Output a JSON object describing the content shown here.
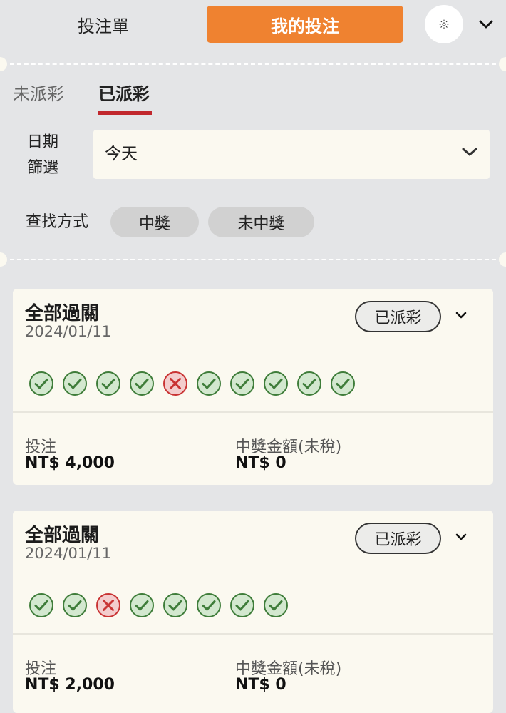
{
  "header": {
    "tab_betslip": "投注單",
    "tab_mybets": "我的投注",
    "accent_color": "#ef8230"
  },
  "subtabs": {
    "unsettled": "未派彩",
    "settled": "已派彩"
  },
  "filter": {
    "date_label": "日期篩選",
    "date_value": "今天",
    "search_label": "查找方式",
    "options": [
      "中獎",
      "未中獎"
    ]
  },
  "bets": [
    {
      "type": "全部過關",
      "date": "2024/01/11",
      "status": "已派彩",
      "legs": [
        "win",
        "win",
        "win",
        "win",
        "lose",
        "win",
        "win",
        "win",
        "win",
        "win"
      ],
      "stake_label": "投注",
      "stake": "NT$ 4,000",
      "payout_label": "中獎金額(未稅)",
      "payout": "NT$ 0"
    },
    {
      "type": "全部過關",
      "date": "2024/01/11",
      "status": "已派彩",
      "legs": [
        "win",
        "win",
        "lose",
        "win",
        "win",
        "win",
        "win",
        "win"
      ],
      "stake_label": "投注",
      "stake": "NT$ 2,000",
      "payout_label": "中獎金額(未稅)",
      "payout": "NT$ 0"
    }
  ]
}
